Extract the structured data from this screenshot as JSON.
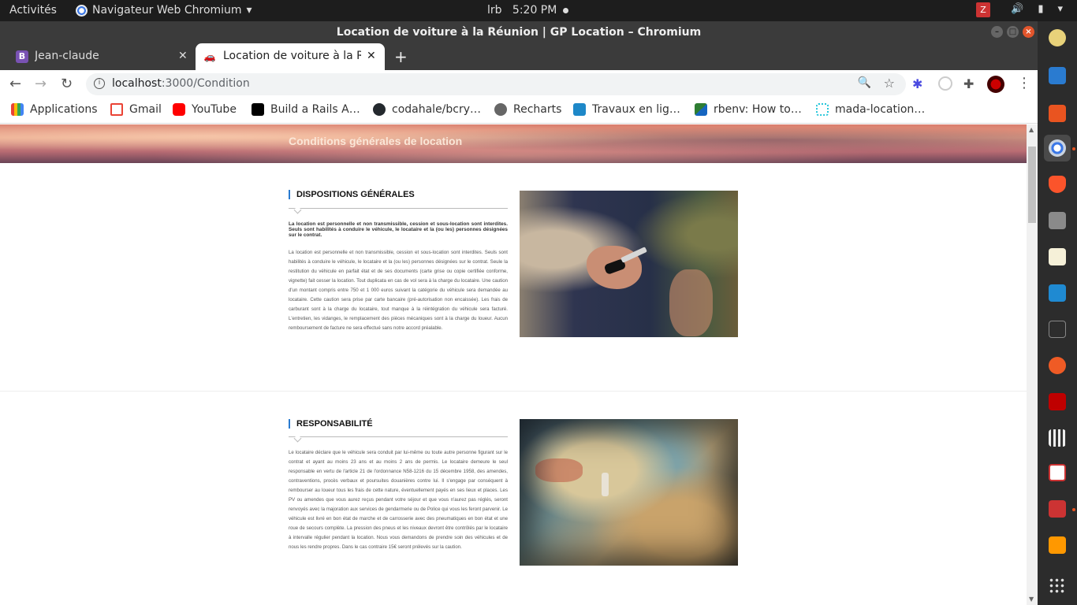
{
  "topbar": {
    "activities": "Activités",
    "app_name": "Navigateur Web Chromium",
    "app_menu_arrow": "▾",
    "clock_user": "lrb",
    "clock_time": "5:20 PM"
  },
  "window": {
    "title": "Location de voiture à la Réunion | GP Location – Chromium"
  },
  "tabs": [
    {
      "label": "Jean-claude",
      "favicon": "bootstrap-icon",
      "favicon_color": "#7952b3",
      "favicon_letter": "B"
    },
    {
      "label": "Location de voiture à la Ré",
      "favicon": "car-icon",
      "favicon_color": "#555555",
      "favicon_letter": "🚗"
    }
  ],
  "omnibox": {
    "host": "localhost",
    "path": ":3000/Condition"
  },
  "bookmarks": [
    {
      "label": "Applications",
      "icon": "apps-grid-icon",
      "color": "#4285f4"
    },
    {
      "label": "Gmail",
      "icon": "gmail-icon",
      "color": "#ea4335"
    },
    {
      "label": "YouTube",
      "icon": "youtube-icon",
      "color": "#ff0000"
    },
    {
      "label": "Build a Rails A…",
      "icon": "medium-icon",
      "color": "#000000"
    },
    {
      "label": "codahale/bcry…",
      "icon": "github-icon",
      "color": "#24292e"
    },
    {
      "label": "Recharts",
      "icon": "globe-icon",
      "color": "#555555"
    },
    {
      "label": "Travaux en lig…",
      "icon": "travaux-icon",
      "color": "#1e88c8"
    },
    {
      "label": "rbenv: How to…",
      "icon": "rbenv-icon",
      "color": "#2e7d32"
    },
    {
      "label": "mada-location…",
      "icon": "dotted-square-icon",
      "color": "#26c6da"
    }
  ],
  "page": {
    "hero_title": "Conditions générales de location",
    "sections": [
      {
        "heading": "DISPOSITIONS GÉNÉRALES",
        "lead": "La location est personnelle et non transmissible, cession et sous-location sont interdites. Seuls sont habilités à conduire le véhicule, le locataire et la (ou les) personnes désignées sur le contrat.",
        "body": "La location est personnelle et non transmissible, cession et sous-location sont interdites. Seuls sont habilités à conduire le véhicule, le locataire et la (ou les) personnes désignées sur le contrat. Seule la restitution du véhicule en parfait état et de ses documents (carte grise ou copie certifiée conforme, vignette) fait cesser la location. Tout duplicata en cas de vol sera à la charge du locataire. Une caution d'un montant compris entre 750 et 1 000 euros suivant la catégorie du véhicule sera demandée au locataire. Cette caution sera prise par carte bancaire (pré-autorisation non encaissée). Les frais de carburant sont à la charge du locataire, tout manque à la réintégration du véhicule sera facturé. L'entretien, les vidanges, le remplacement des pièces mécaniques sont à la charge du loueur. Aucun remboursement de facture ne sera effectué sans notre accord préalable."
      },
      {
        "heading": "RESPONSABILITÉ",
        "body": "Le locataire déclare que le véhicule sera conduit par lui-même ou toute autre personne figurant sur le contrat et ayant au moins 23 ans et au moins 2 ans de permis. Le locataire demeure le seul responsable en vertu de l'article 21 de l'ordonnance N58-1216 du 15 décembre 1958, des amendes, contraventions, procès verbaux et poursuites douanières contre lui. Il s'engage par conséquent à rembourser au loueur tous les frais de cette nature, éventuellement payés en ses lieux et places. Les PV ou amendes que vous aurez reçus pendant votre séjour et que vous n'aurez pas réglés, seront renvoyés avec la majoration aux services de gendarmerie ou de Police qui vous les feront parvenir. Le véhicule est livré en bon état de marche et de carrosserie avec des pneumatiques en bon état et une roue de secours complète. La pression des pneus et les niveaux devront être contrôlés par le locataire à intervalle régulier pendant la location. Nous vous demandons de prendre soin des véhicules et de nous les rendre propres. Dans le cas contraire 15€ seront prélevés sur la caution."
      }
    ]
  },
  "colors": {
    "accent": "#2a7bd0",
    "ubuntu_orange": "#e95420",
    "titlebar": "#3b3b3b"
  }
}
